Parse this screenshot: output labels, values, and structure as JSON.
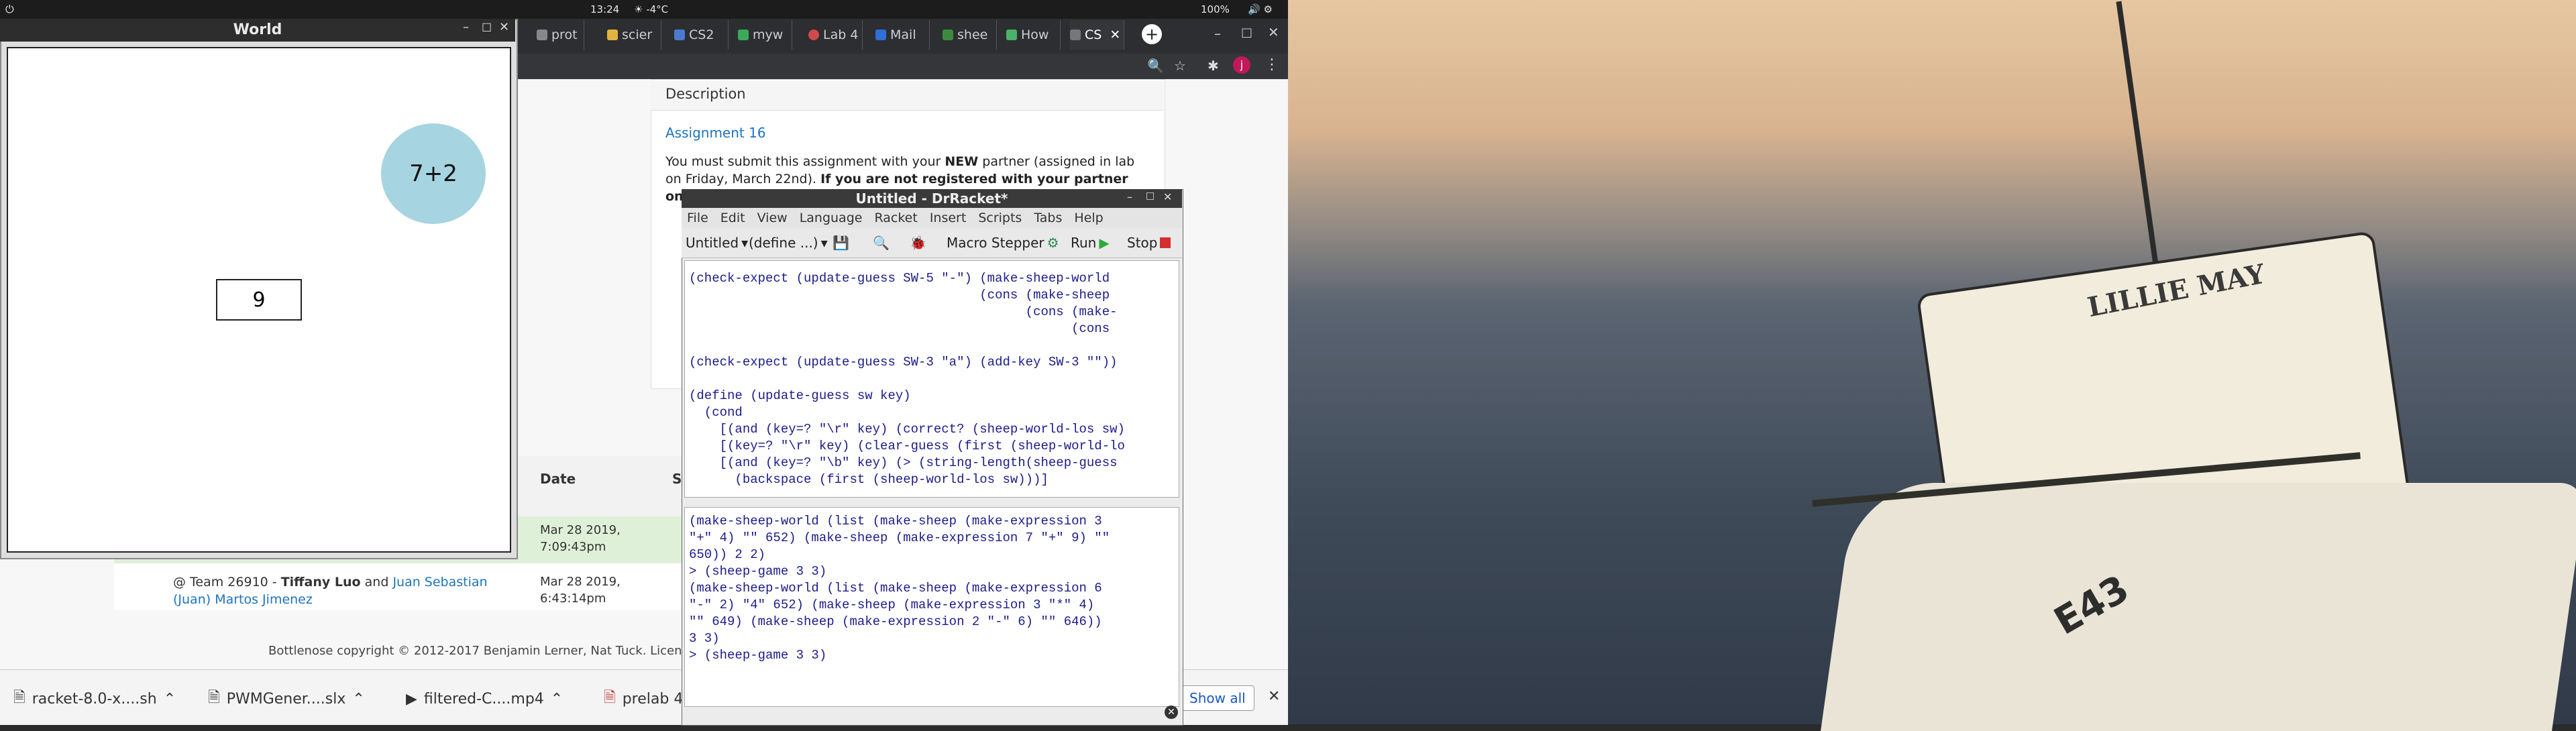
{
  "top_panel": {
    "clock": "13:24",
    "weather": "☀ -4°C",
    "battery": "100%"
  },
  "browser": {
    "tabs": [
      {
        "label": "prot"
      },
      {
        "label": "scier"
      },
      {
        "label": "CS2"
      },
      {
        "label": "myw"
      },
      {
        "label": "Lab 4"
      },
      {
        "label": "Mail"
      },
      {
        "label": "shee"
      },
      {
        "label": "How"
      },
      {
        "label": "CS"
      }
    ],
    "description_heading": "Description",
    "assignment_link": "Assignment 16",
    "paragraph_1a": "You must submit this assignment with your",
    "paragraph_1b": "NEW",
    "paragraph_1c": "partner (assigned in lab on Friday, March 22nd).",
    "paragraph_1d": "If you are not registered with your partner on the handin server",
    "table_headers": {
      "date": "Date",
      "status": "S"
    },
    "row1_date": "Mar 28 2019, 7:09:43pm",
    "row2_team": "@ Team 26910 -",
    "row2_member1": "Tiffany Luo",
    "row2_and": "and",
    "row2_member2": "Juan Sebastian (Juan) Martos Jimenez",
    "row2_date": "Mar 28 2019, 6:43:14pm",
    "footer": "Bottlenose copyright © 2012-2017 Benjamin Lerner, Nat Tuck. Licensed",
    "downloads": [
      {
        "label": "racket-8.0-x....sh"
      },
      {
        "label": "PWMGener....slx"
      },
      {
        "label": "filtered-C....mp4"
      },
      {
        "label": "prelab 4"
      }
    ],
    "show_all": "Show all"
  },
  "world": {
    "title": "World",
    "bubble_text": "7+2",
    "guess_value": "9"
  },
  "drracket": {
    "title": "Untitled - DrRacket*",
    "menu": [
      "File",
      "Edit",
      "View",
      "Language",
      "Racket",
      "Insert",
      "Scripts",
      "Tabs",
      "Help"
    ],
    "file_selector": "Untitled",
    "define_selector": "(define ...)",
    "macro_stepper": "Macro Stepper",
    "run": "Run",
    "stop": "Stop",
    "definitions_code": "(check-expect (update-guess SW-5 \"-\") (make-sheep-world\n                                      (cons (make-sheep\n                                            (cons (make-\n                                                  (cons\n\n(check-expect (update-guess SW-3 \"a\") (add-key SW-3 \"\"))\n\n(define (update-guess sw key)\n  (cond\n    [(and (key=? \"\\r\" key) (correct? (sheep-world-los sw)\n    [(key=? \"\\r\" key) (clear-guess (first (sheep-world-lo\n    [(and (key=? \"\\b\" key) (> (string-length(sheep-guess\n      (backspace (first (sheep-world-los sw)))]",
    "interactions_code": "(make-sheep-world (list (make-sheep (make-expression 3\n\"+\" 4) \"\" 652) (make-sheep (make-expression 7 \"+\" 9) \"\"\n650)) 2 2)\n> (sheep-game 3 3)\n(make-sheep-world (list (make-sheep (make-expression 6\n\"-\" 2) \"4\" 652) (make-sheep (make-expression 3 \"*\" 4)\n\"\" 649) (make-sheep (make-expression 2 \"-\" 6) \"\" 646))\n3 3)\n> (sheep-game 3 3)"
  },
  "desktop": {
    "boat_name": "LILLIE MAY",
    "boat_registration": "E43"
  }
}
